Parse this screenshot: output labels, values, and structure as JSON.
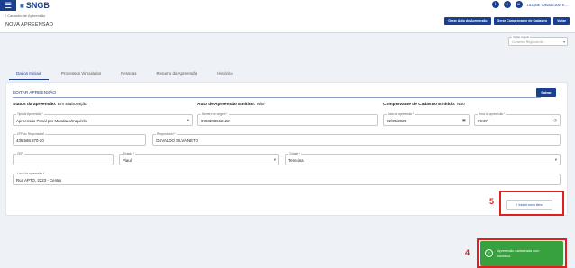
{
  "app": {
    "logo_text": "SNGB",
    "menu_icon": "hamburger-icon"
  },
  "topbar": {
    "user_name": "LILIANE CAVALCANTE..."
  },
  "breadcrumb": "/ Cadastro de Apreensão",
  "page_title": "NOVA APREENSÃO",
  "header_buttons": [
    "Gerar Auto de Apreensão",
    "Gerar Comprovante de Cadastro",
    "Voltar"
  ],
  "org_select": {
    "label": "Órgão logado",
    "value": "Conselho Regional de..."
  },
  "tabs": [
    "Dados Iniciais",
    "Processos Vinculados",
    "Pessoas",
    "Resumo da Apreensão",
    "Histórico"
  ],
  "card": {
    "title": "EDITAR APREENSÃO",
    "save_label": "Salvar",
    "status_apreensao": {
      "label": "Status da apreensão:",
      "value": "Em Elaboração"
    },
    "auto_emitido": {
      "label": "Auto de Apreensão Emitido:",
      "value": "Não"
    },
    "comprovante_emitido": {
      "label": "Comprovante de Cadastro Emitido:",
      "value": "Não"
    }
  },
  "fields": {
    "tipo_apreensao": {
      "label": "Tipo de Apreensão *",
      "value": "Apreensão Penal por Mandado/Inquérito"
    },
    "numero_origem": {
      "label": "Número de origem *",
      "value": "9703293662122"
    },
    "data_apreensao": {
      "label": "Data da apreensão *",
      "value": "02/05/2025"
    },
    "hora_apreensao": {
      "label": "Hora da apreensão *",
      "value": "09:37"
    },
    "cpf_responsavel": {
      "label": "CPF do Responsável",
      "value": "435.568.870-20"
    },
    "responsavel": {
      "label": "Responsável *",
      "value": "OSVALDO SILVA NETO"
    },
    "cep": {
      "label": "CEP",
      "value": ""
    },
    "estado": {
      "label": "Estado *",
      "value": "Piauí"
    },
    "cidade": {
      "label": "Cidade *",
      "value": "Teresina"
    },
    "local": {
      "label": "Local da apreensão *",
      "value": "Rua APTO, 2223 - Centro"
    }
  },
  "incluir_button": "Incluir novo item",
  "annotation_5": "5",
  "toast": {
    "message": "Apreensão cadastrada com sucesso."
  },
  "annotation_4": "4",
  "colors": {
    "primary": "#1b3f8f",
    "success": "#37a13e",
    "highlight": "#e02020"
  }
}
